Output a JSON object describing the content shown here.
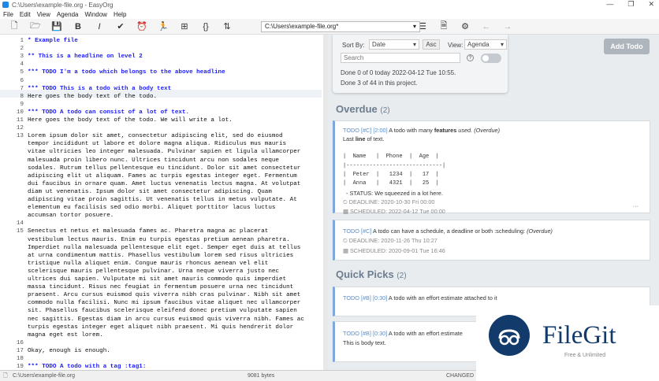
{
  "titlebar": {
    "title": "C:\\Users\\example-file.org - EasyOrg",
    "minimize": "—",
    "restore": "❐",
    "close": "✕"
  },
  "menu": [
    "File",
    "Edit",
    "View",
    "Agenda",
    "Window",
    "Help"
  ],
  "toolbar": {
    "path": "C:\\Users\\example-file.org*",
    "dropdown": "▾",
    "back": "←",
    "forward": "→"
  },
  "editor": {
    "lines": [
      {
        "n": "1",
        "t": "* Example file",
        "h": true
      },
      {
        "n": "2",
        "t": "",
        "h": false
      },
      {
        "n": "3",
        "t": "** This is a headline on level 2",
        "h": true
      },
      {
        "n": "4",
        "t": "",
        "h": false
      },
      {
        "n": "5",
        "t": "*** TODO I'm a todo which belongs to the above headline",
        "h": true
      },
      {
        "n": "6",
        "t": "",
        "h": false
      },
      {
        "n": "7",
        "t": "*** TODO This is a todo with a body text",
        "h": true
      },
      {
        "n": "8",
        "t": "Here goes the body text of the todo.",
        "h": false
      },
      {
        "n": "9",
        "t": "",
        "h": false
      },
      {
        "n": "10",
        "t": "*** TODO A todo can consist of a lot of text.",
        "h": true
      },
      {
        "n": "11",
        "t": "Here goes the body text of the todo. We will write a lot.",
        "h": false
      },
      {
        "n": "12",
        "t": "",
        "h": false
      },
      {
        "n": "13",
        "t": "Lorem ipsum dolor sit amet, consectetur adipiscing elit, sed do eiusmod",
        "h": false
      },
      {
        "n": "",
        "t": "tempor incididunt ut labore et dolore magna aliqua. Ridiculus mus mauris",
        "h": false
      },
      {
        "n": "",
        "t": "vitae ultricies leo integer malesuada. Pulvinar sapien et ligula ullamcorper",
        "h": false
      },
      {
        "n": "",
        "t": "malesuada proin libero nunc. Ultrices tincidunt arcu non sodales neque",
        "h": false
      },
      {
        "n": "",
        "t": "sodales. Rutrum tellus pellentesque eu tincidunt. Dolor sit amet consectetur",
        "h": false
      },
      {
        "n": "",
        "t": "adipiscing elit ut aliquam. Fames ac turpis egestas integer eget. Fermentum",
        "h": false
      },
      {
        "n": "",
        "t": "dui faucibus in ornare quam. Amet luctus venenatis lectus magna. At volutpat",
        "h": false
      },
      {
        "n": "",
        "t": "diam ut venenatis. Ipsum dolor sit amet consectetur adipiscing. Quam",
        "h": false
      },
      {
        "n": "",
        "t": "adipiscing vitae proin sagittis. Ut venenatis tellus in metus vulputate. At",
        "h": false
      },
      {
        "n": "",
        "t": "elementum eu facilisis sed odio morbi. Aliquet porttitor lacus luctus",
        "h": false
      },
      {
        "n": "",
        "t": "accumsan tortor posuere.",
        "h": false
      },
      {
        "n": "14",
        "t": "",
        "h": false
      },
      {
        "n": "15",
        "t": "Senectus et netus et malesuada fames ac. Pharetra magna ac placerat",
        "h": false
      },
      {
        "n": "",
        "t": "vestibulum lectus mauris. Enim eu turpis egestas pretium aenean pharetra.",
        "h": false
      },
      {
        "n": "",
        "t": "Imperdiet nulla malesuada pellentesque elit eget. Semper eget duis at tellus",
        "h": false
      },
      {
        "n": "",
        "t": "at urna condimentum mattis. Phasellus vestibulum lorem sed risus ultricies",
        "h": false
      },
      {
        "n": "",
        "t": "tristique nulla aliquet enim. Congue mauris rhoncus aenean vel elit",
        "h": false
      },
      {
        "n": "",
        "t": "scelerisque mauris pellentesque pulvinar. Urna neque viverra justo nec",
        "h": false
      },
      {
        "n": "",
        "t": "ultrices dui sapien. Vulputate mi sit amet mauris commodo quis imperdiet",
        "h": false
      },
      {
        "n": "",
        "t": "massa tincidunt. Risus nec feugiat in fermentum posuere urna nec tincidunt",
        "h": false
      },
      {
        "n": "",
        "t": "praesent. Arcu cursus euismod quis viverra nibh cras pulvinar. Nibh sit amet",
        "h": false
      },
      {
        "n": "",
        "t": "commodo nulla facilisi. Nunc mi ipsum faucibus vitae aliquet nec ullamcorper",
        "h": false
      },
      {
        "n": "",
        "t": "sit. Phasellus faucibus scelerisque eleifend donec pretium vulputate sapien",
        "h": false
      },
      {
        "n": "",
        "t": "nec sagittis. Egestas diam in arcu cursus euismod quis viverra nibh. Fames ac",
        "h": false
      },
      {
        "n": "",
        "t": "turpis egestas integer eget aliquet nibh praesent. Mi quis hendrerit dolor",
        "h": false
      },
      {
        "n": "",
        "t": "magna eget est lorem.",
        "h": false
      },
      {
        "n": "16",
        "t": "",
        "h": false
      },
      {
        "n": "17",
        "t": "Okay, enough is enough.",
        "h": false
      },
      {
        "n": "18",
        "t": "",
        "h": false
      },
      {
        "n": "19",
        "t": "*** TODO A todo with a tag :tag1:",
        "h": true
      }
    ]
  },
  "agenda": {
    "sort_label": "Sort By:",
    "sort_value": "Date",
    "asc": "Asc",
    "view_label": "View:",
    "view_value": "Agenda",
    "search_placeholder": "Search",
    "help": "?",
    "done_today": "Done 0 of 0 today 2022-04-12 Tue 10:55.",
    "done_project": "Done 3 of 44 in this project.",
    "add_todo": "Add Todo",
    "overdue_title": "Overdue",
    "overdue_count": "(2)",
    "quick_title": "Quick Picks",
    "quick_count": "(2)",
    "card1": {
      "head": "TODO [#C] [2:00]",
      "text": "A todo with many",
      "bold": "features",
      "rest": "used.",
      "tag": "(Overdue)",
      "last": "Last",
      "line": "line",
      "oftext": "of text.",
      "table": [
        "|  Name   |  Phone  |  Age  |",
        "|-----------------------------|",
        "|  Peter  |   1234  |   17  |",
        "|  Anna   |   4321  |   25  |"
      ],
      "status": "- STATUS: We squeezed in a lot here.",
      "deadline": "DEADLINE: 2020-10-30 Fri 00:00",
      "scheduled": "SCHEDULED: 2022-04-12 Tue 00:00",
      "more": "···"
    },
    "card2": {
      "head": "TODO [#C]",
      "text": "A todo can have a schedule, a deadline or both :scheduling:",
      "tag": "(Overdue)",
      "deadline": "DEADLINE: 2020-11-26 Thu 10:27",
      "scheduled": "SCHEDULED: 2020-09-01 Tue 16:46"
    },
    "card3": {
      "head": "TODO [#B] [0:30]",
      "text": "A todo with an effort estimate attached to it",
      "more": "···"
    },
    "card4": {
      "head": "TODO [#B] [0:30]",
      "text": "A todo with an effort estimate",
      "body": "This is body text."
    }
  },
  "status": {
    "path": "C:\\Users\\example-file.org",
    "bytes": "9081 bytes",
    "changed": "CHANGED"
  },
  "watermark": {
    "name": "FileGit",
    "sub": "Free & Unlimited"
  }
}
